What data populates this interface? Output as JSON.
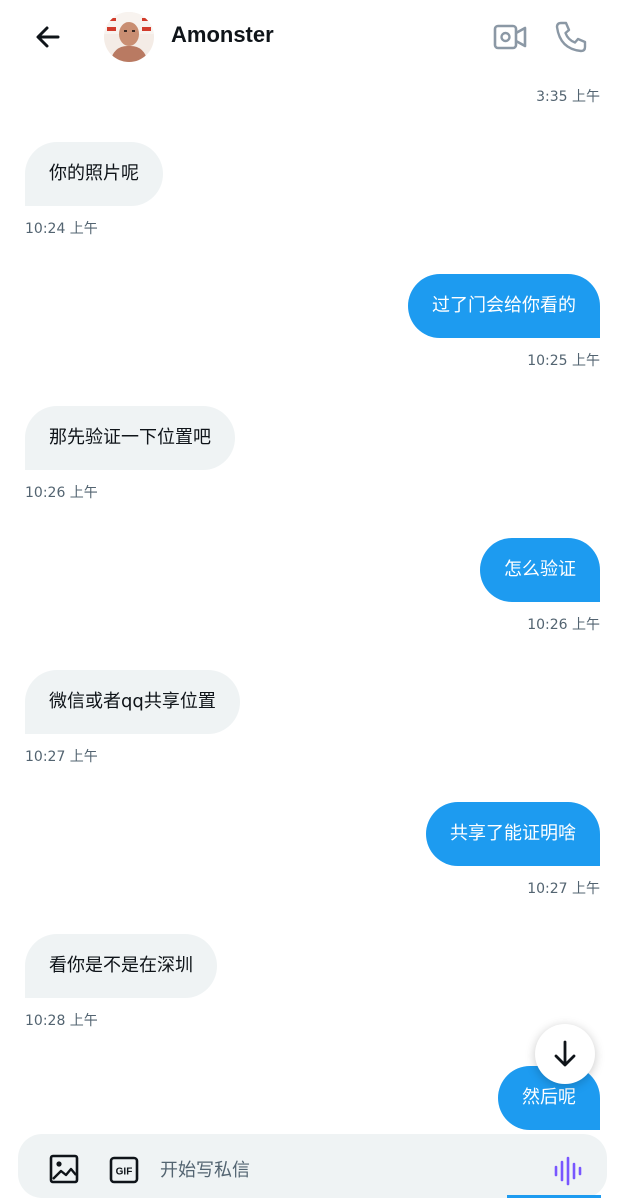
{
  "header": {
    "contact_name": "Amonster",
    "back_icon": "arrow-left-icon",
    "video_icon": "video-camera-icon",
    "call_icon": "phone-icon"
  },
  "messages": [
    {
      "direction": "meta",
      "time": "3:35 上午"
    },
    {
      "direction": "in",
      "text": "你的照片呢",
      "time": "10:24 上午"
    },
    {
      "direction": "out",
      "text": "过了门会给你看的",
      "time": "10:25 上午"
    },
    {
      "direction": "in",
      "text": "那先验证一下位置吧",
      "time": "10:26 上午"
    },
    {
      "direction": "out",
      "text": "怎么验证",
      "time": "10:26 上午"
    },
    {
      "direction": "in",
      "text": "微信或者qq共享位置",
      "time": "10:27 上午"
    },
    {
      "direction": "out",
      "text": "共享了能证明啥",
      "time": "10:27 上午"
    },
    {
      "direction": "in",
      "text": "看你是不是在深圳",
      "time": "10:28 上午"
    },
    {
      "direction": "out",
      "text": "然后呢"
    }
  ],
  "composer": {
    "placeholder": "开始写私信",
    "gif_label": "GIF",
    "image_icon": "image-icon",
    "voice_icon": "voice-waveform-icon"
  },
  "colors": {
    "accent": "#1d9bf0",
    "incoming_bubble": "#eff3f4",
    "timestamp": "#536471",
    "voice": "#7856ff"
  }
}
